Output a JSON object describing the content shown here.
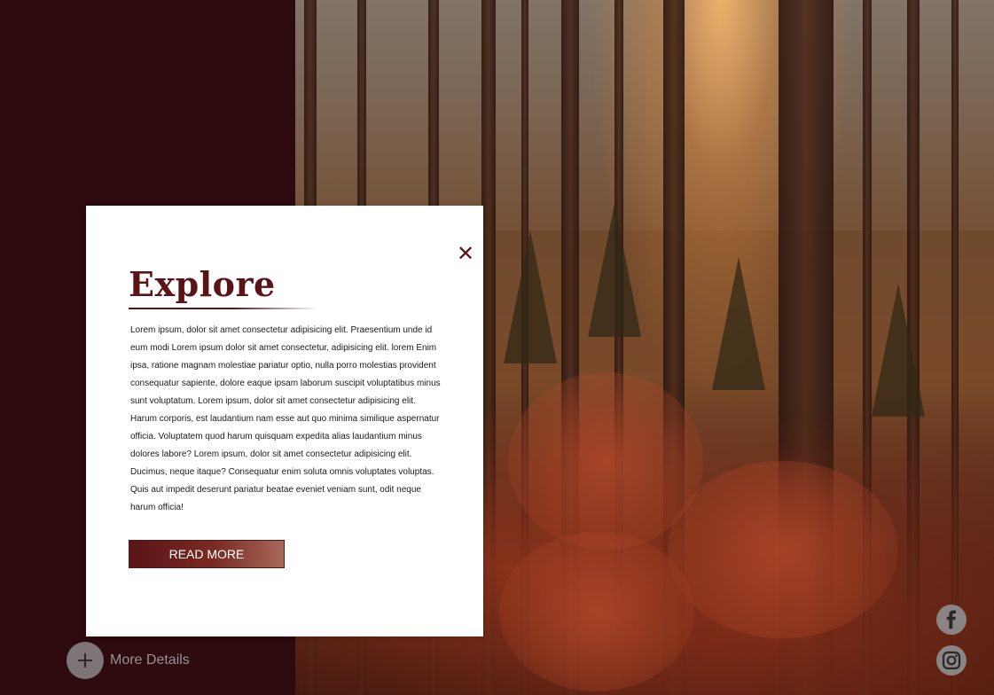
{
  "modal": {
    "title": "Explore",
    "close_icon": "close-icon",
    "body": "Lorem ipsum, dolor sit amet consectetur adipisicing elit. Praesentium unde id eum modi Lorem ipsum dolor sit amet consectetur, adipisicing elit. lorem Enim ipsa, ratione magnam molestiae pariatur optio, nulla porro molestias provident consequatur sapiente, dolore eaque ipsam laborum suscipit voluptatibus minus sunt voluptatum. Lorem ipsum, dolor sit amet consectetur adipisicing elit. Harum corporis, est laudantium nam esse aut quo minima similique aspernatur officia. Voluptatem quod harum quisquam expedita alias laudantium minus dolores labore? Lorem ipsum, dolor sit amet consectetur adipisicing elit. Ducimus, neque itaque? Consequatur enim soluta omnis voluptates voluptas. Quis aut impedit deserunt pariatur beatae eveniet veniam sunt, odit neque harum officia!",
    "read_more_label": "READ MORE"
  },
  "footer": {
    "more_details_label": "More Details",
    "more_details_icon": "plus-icon"
  },
  "social": {
    "facebook_icon": "facebook-icon",
    "instagram_icon": "instagram-icon"
  },
  "colors": {
    "brand": "#5a1418",
    "sidebar_bg": "#2c0a0e",
    "modal_bg": "#ffffff",
    "muted_icon": "#8a8484"
  }
}
